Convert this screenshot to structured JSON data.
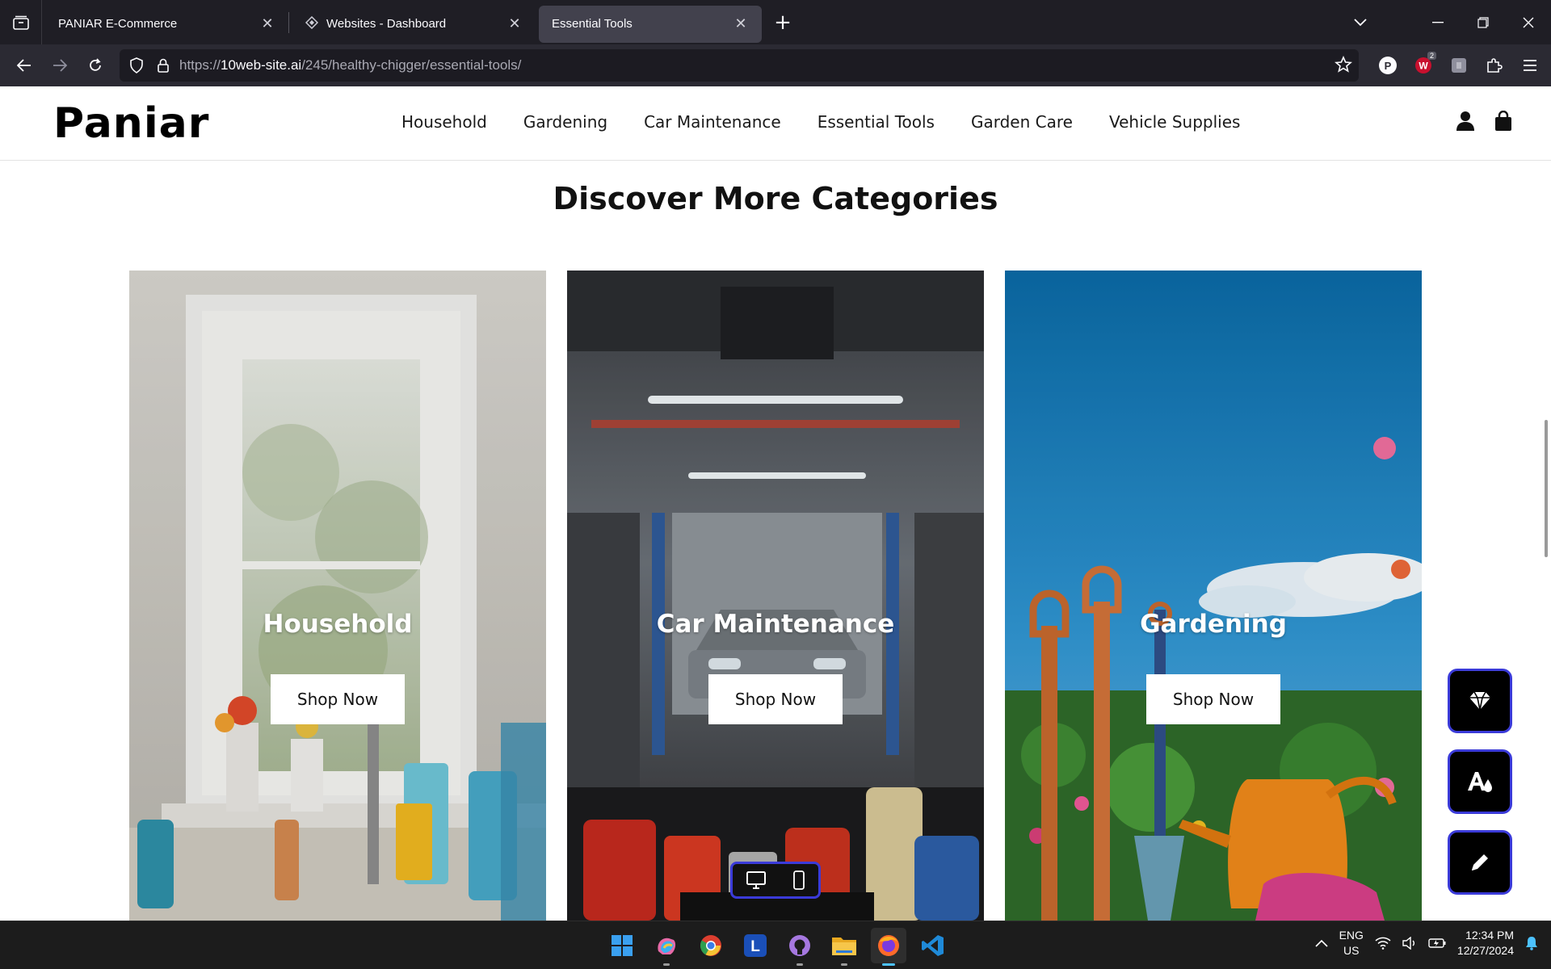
{
  "browser": {
    "tabs": [
      {
        "title": "PANIAR E-Commerce",
        "active": false
      },
      {
        "title": "Websites - Dashboard",
        "active": false
      },
      {
        "title": "Essential Tools",
        "active": true
      }
    ],
    "url_prefix": "https://",
    "url_host": "10web-site.ai",
    "url_path": "/245/healthy-chigger/essential-tools/",
    "extension_badge": "2"
  },
  "site": {
    "logo": "Paniar",
    "nav": [
      "Household",
      "Gardening",
      "Car Maintenance",
      "Essential Tools",
      "Garden Care",
      "Vehicle Supplies"
    ]
  },
  "content": {
    "section_title": "Discover More Categories",
    "cards": [
      {
        "title": "Household",
        "button": "Shop Now"
      },
      {
        "title": "Car Maintenance",
        "button": "Shop Now"
      },
      {
        "title": "Gardening",
        "button": "Shop Now"
      }
    ]
  },
  "taskbar": {
    "lang_top": "ENG",
    "lang_bottom": "US",
    "time": "12:34 PM",
    "date": "12/27/2024"
  },
  "colors": {
    "accent": "#3b3bd9",
    "chrome_dark": "#1f1e25",
    "taskbar": "#1c1c1c"
  }
}
